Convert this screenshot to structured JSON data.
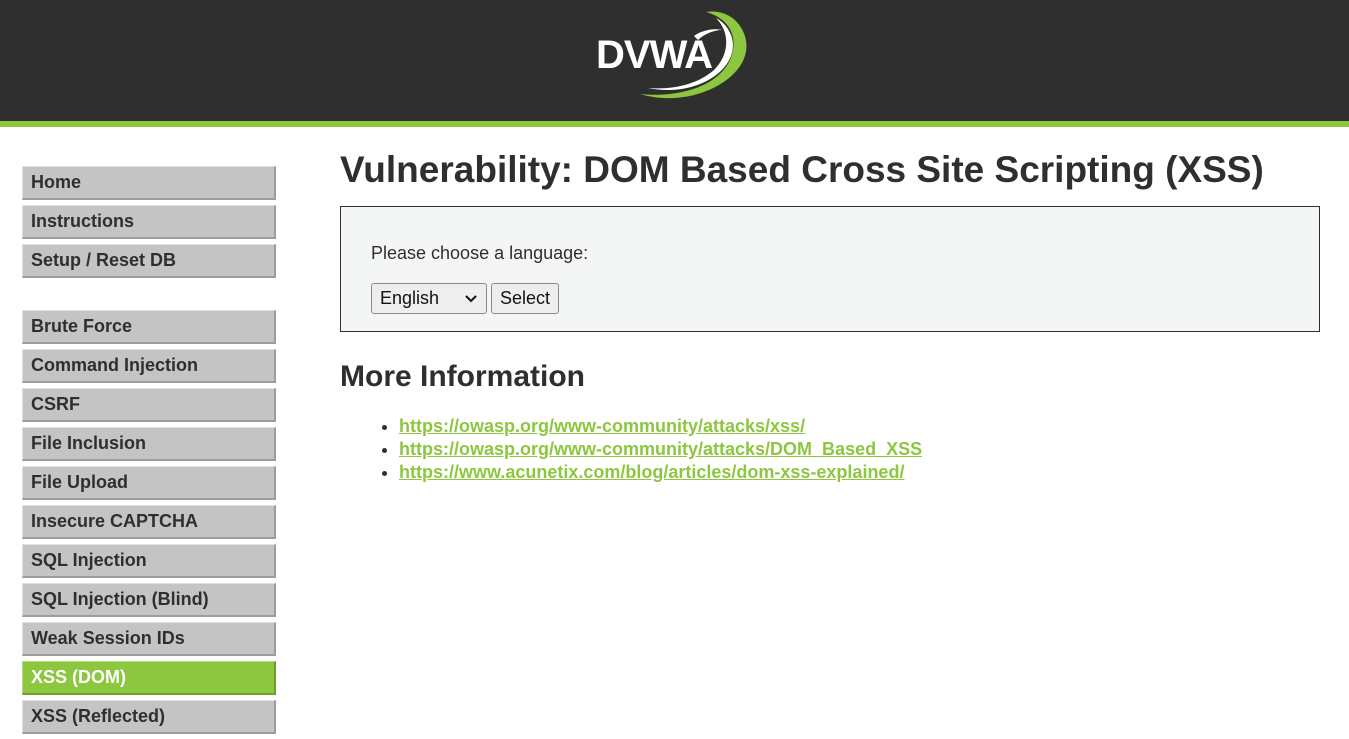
{
  "header": {
    "logo_text": "DVWA",
    "accent_color": "#8dc63f",
    "background_color": "#2f2f2f"
  },
  "sidebar": {
    "groups": [
      {
        "items": [
          {
            "label": "Home"
          },
          {
            "label": "Instructions"
          },
          {
            "label": "Setup / Reset DB"
          }
        ]
      },
      {
        "items": [
          {
            "label": "Brute Force"
          },
          {
            "label": "Command Injection"
          },
          {
            "label": "CSRF"
          },
          {
            "label": "File Inclusion"
          },
          {
            "label": "File Upload"
          },
          {
            "label": "Insecure CAPTCHA"
          },
          {
            "label": "SQL Injection"
          },
          {
            "label": "SQL Injection (Blind)"
          },
          {
            "label": "Weak Session IDs"
          },
          {
            "label": "XSS (DOM)",
            "selected": true
          },
          {
            "label": "XSS (Reflected)"
          }
        ]
      }
    ]
  },
  "main": {
    "title": "Vulnerability: DOM Based Cross Site Scripting (XSS)",
    "form": {
      "prompt": "Please choose a language:",
      "language_selected": "English",
      "select_button": "Select"
    },
    "more_info": {
      "heading": "More Information",
      "links": [
        "https://owasp.org/www-community/attacks/xss/",
        "https://owasp.org/www-community/attacks/DOM_Based_XSS",
        "https://www.acunetix.com/blog/articles/dom-xss-explained/"
      ]
    }
  }
}
